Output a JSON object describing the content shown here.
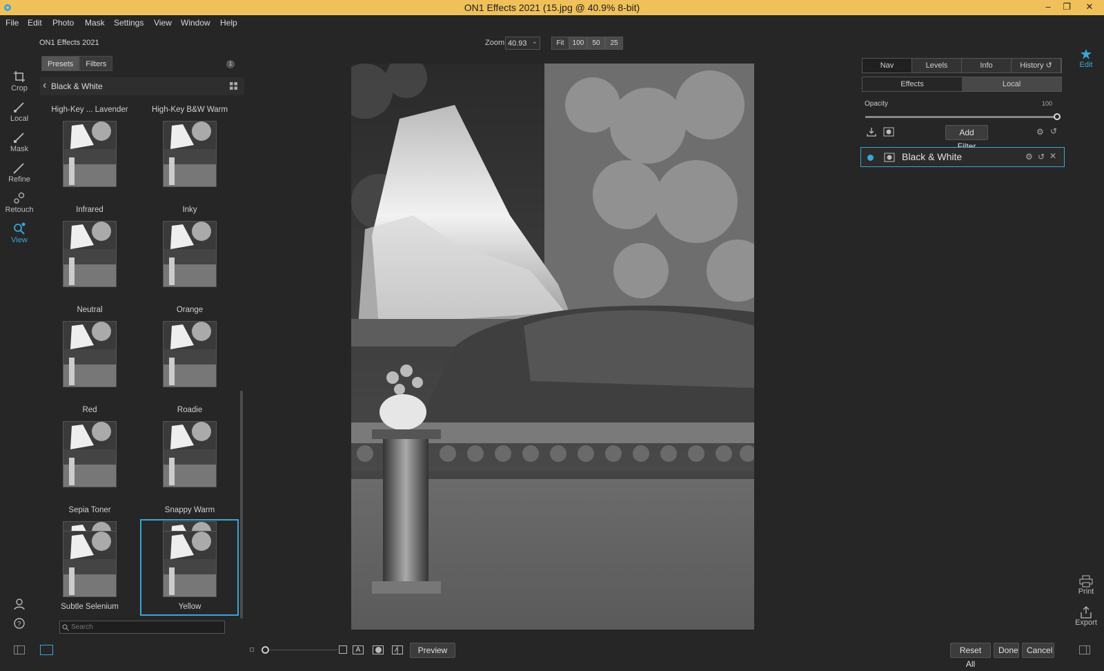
{
  "window": {
    "title": "ON1 Effects 2021 (15.jpg @ 40.9% 8-bit)"
  },
  "menu": [
    "File",
    "Edit",
    "Photo",
    "Mask",
    "Settings",
    "View",
    "Window",
    "Help"
  ],
  "app": {
    "name": "ON1 Effects 2021",
    "logo_text": "FX"
  },
  "tools_left": [
    {
      "label": "Crop",
      "icon": "crop-icon"
    },
    {
      "label": "Local",
      "icon": "brush-icon"
    },
    {
      "label": "Mask",
      "icon": "mask-brush-icon"
    },
    {
      "label": "Refine",
      "icon": "refine-brush-icon"
    },
    {
      "label": "Retouch",
      "icon": "retouch-icon"
    },
    {
      "label": "View",
      "icon": "view-icon",
      "active": true
    }
  ],
  "browser": {
    "tabs": [
      "Presets",
      "Filters"
    ],
    "active_tab": "Presets",
    "count": "1",
    "category": "Black & White",
    "presets": [
      "High-Key ... Lavender",
      "High-Key B&W Warm",
      "Infrared",
      "Inky",
      "Neutral",
      "Orange",
      "Red",
      "Roadie",
      "Sepia Toner",
      "Snappy Warm",
      "Subtle Selenium",
      "Yellow"
    ],
    "selected": "Yellow",
    "search_placeholder": "Search"
  },
  "zoom": {
    "label": "Zoom",
    "value": "40.93",
    "buttons": [
      "Fit",
      "100",
      "50",
      "25"
    ]
  },
  "right_panel": {
    "tabs": [
      "Nav",
      "Levels",
      "Info",
      "History"
    ],
    "active_tab": "Nav",
    "subtabs": [
      "Effects",
      "Local"
    ],
    "active_subtab": "Effects",
    "opacity_label": "Opacity",
    "opacity_value": "100",
    "add_filter": "Add Filter",
    "layer_name": "Black & White"
  },
  "right_tools": [
    {
      "label": "Edit",
      "icon": "edit-gear-icon"
    },
    {
      "label": "Print",
      "icon": "printer-icon"
    },
    {
      "label": "Export",
      "icon": "export-icon"
    }
  ],
  "bottom": {
    "preview": "Preview",
    "reset_all": "Reset All",
    "done": "Done",
    "cancel": "Cancel"
  },
  "colors": {
    "accent": "#3aa6d6",
    "titlebar": "#f0c15a",
    "background": "#262626"
  }
}
